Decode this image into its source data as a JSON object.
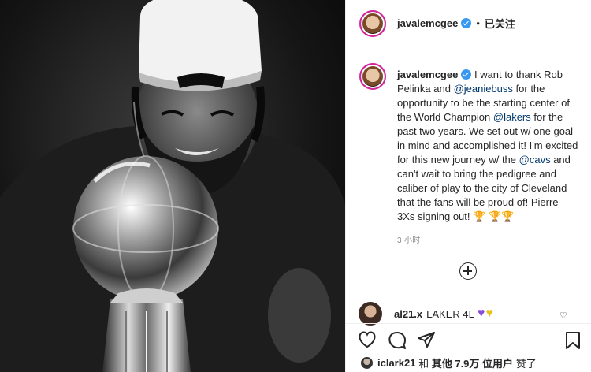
{
  "post": {
    "username": "javalemcgee",
    "dot": "•",
    "follow_label": "已关注",
    "caption_start": "I want to thank Rob Pelinka and ",
    "mention_1": "@jeaniebuss",
    "caption_mid_1": " for the opportunity to be the starting center of the World Champion ",
    "mention_2": "@lakers",
    "caption_mid_2": " for the past two years. We set out w/ one goal in mind and accomplished it! I'm excited for this new journey w/ the ",
    "mention_3": "@cavs",
    "caption_end": " and can't wait to bring the pedigree and caliber of play to the city of Cleveland that the fans will be proud of! Pierre 3Xs signing out! ",
    "trophy_emoji": "🏆",
    "trophy_emoji_double": "🏆🏆",
    "time_ago": "3 小时"
  },
  "comment": {
    "username": "al21.x",
    "text": "LAKER 4L",
    "heart_purple": "♥",
    "heart_yellow": "♥",
    "like_icon": "♡"
  },
  "likes": {
    "first_user": "iclark21",
    "and": "和",
    "others_prefix": "其他",
    "count": "7.9万",
    "others_suffix": "位用户",
    "liked": "赞了"
  },
  "icons": {
    "like": "heart-icon",
    "comment": "comment-icon",
    "share": "share-icon",
    "save": "bookmark-icon",
    "add": "plus-circle-icon"
  }
}
